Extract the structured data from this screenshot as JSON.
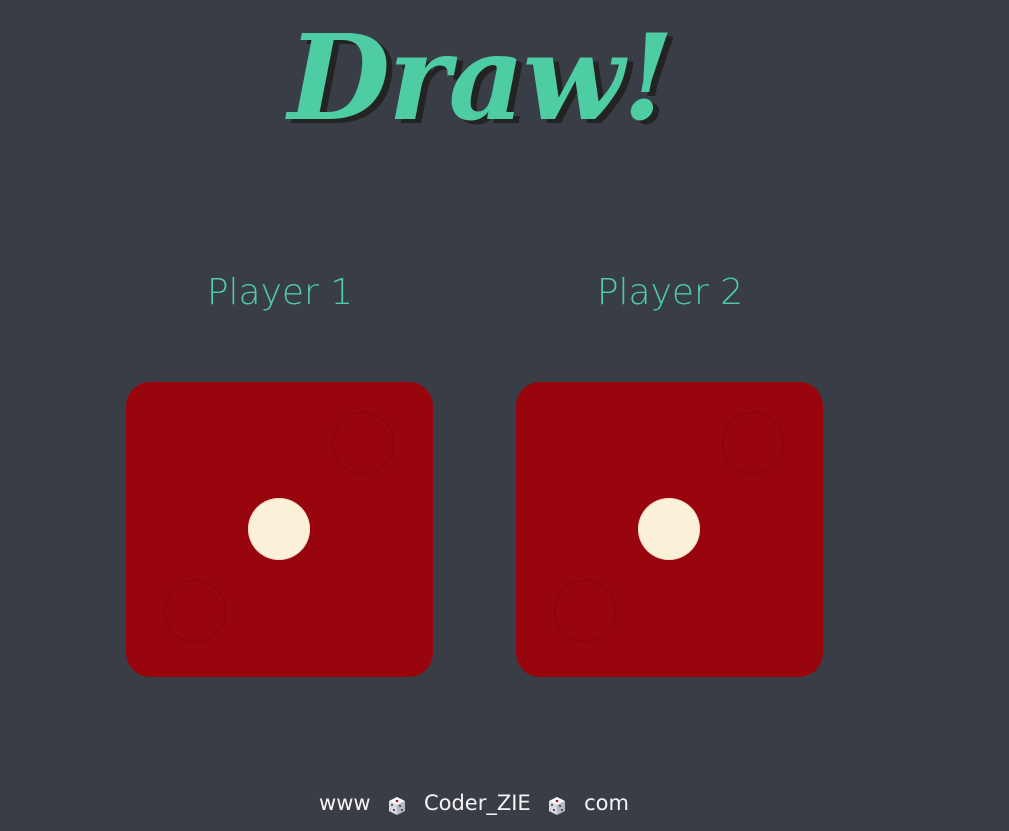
{
  "title": "Draw!",
  "players": [
    {
      "label": "Player 1",
      "die_value": 1
    },
    {
      "label": "Player 2",
      "die_value": 1
    }
  ],
  "footer": {
    "left_text": "www",
    "middle_text": "Coder_ZIE",
    "right_text": "com",
    "separator_icon": "dice-icon"
  },
  "colors": {
    "background": "#393e46",
    "accent": "#4ecca3",
    "die_face": "#99050d",
    "pip": "#fbf0d8"
  }
}
